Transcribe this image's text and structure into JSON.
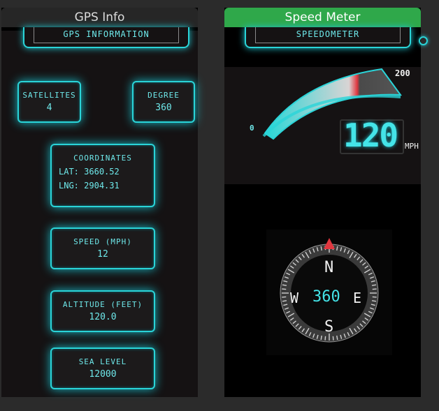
{
  "left_panel": {
    "title": "GPS Info",
    "tab_label": "GPS INFORMATION",
    "satellites": {
      "label": "SATELLITES",
      "value": "4"
    },
    "degree": {
      "label": "DEGREE",
      "value": "360"
    },
    "coordinates": {
      "label": "COORDINATES",
      "lat_label": "LAT:",
      "lat": "3660.52",
      "lng_label": "LNG:",
      "lng": "2904.31"
    },
    "speed": {
      "label": "SPEED (MPH)",
      "value": "12"
    },
    "altitude": {
      "label": "ALTITUDE (FEET)",
      "value": "120.0"
    },
    "sea_level": {
      "label": "SEA LEVEL",
      "value": "12000"
    }
  },
  "right_panel": {
    "title": "Speed Meter",
    "tab_label": "SPEEDOMETER",
    "speedometer": {
      "min_label": "0",
      "max_label": "200",
      "value": "120",
      "unit": "MPH",
      "level": 0.6
    },
    "compass": {
      "heading": "360",
      "north": "N",
      "south": "S",
      "east": "E",
      "west": "W"
    }
  },
  "colors": {
    "accent": "#2ad4d8",
    "header_green": "#2fa84a",
    "needle_red": "#e0373f"
  }
}
